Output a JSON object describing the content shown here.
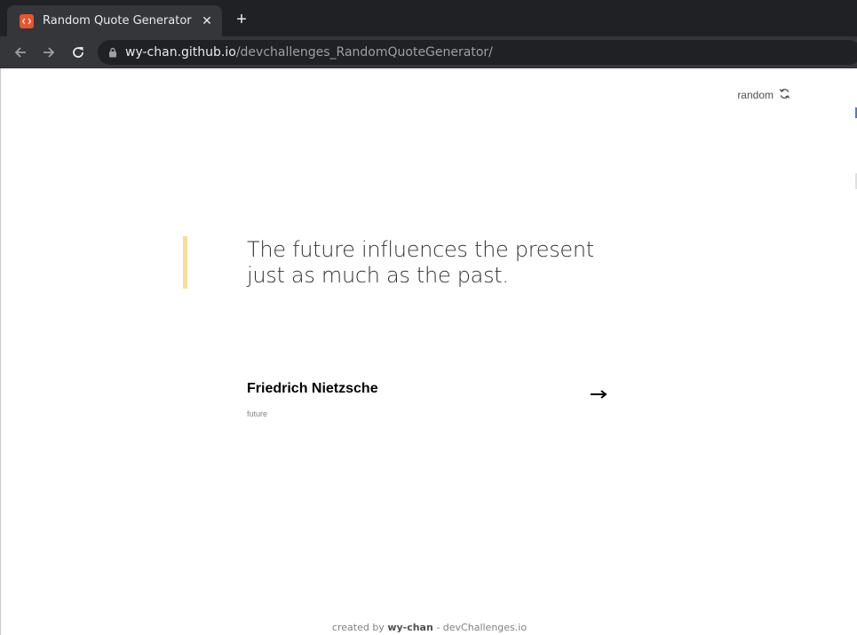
{
  "browser": {
    "tab_title": "Random Quote Generator",
    "tab_close": "✕",
    "new_tab": "+",
    "url_host": "wy-chan.github.io",
    "url_path": "/devchallenges_RandomQuoteGenerator/"
  },
  "header": {
    "random_label": "random"
  },
  "quote": {
    "text": "The future influences the present just as much as the past.",
    "accent_color": "#f7df94"
  },
  "author": {
    "name": "Friedrich Nietzsche",
    "genre": "future"
  },
  "footer": {
    "prefix": "created by",
    "author": "wy-chan",
    "separator": " - ",
    "site": "devChallenges.io"
  }
}
